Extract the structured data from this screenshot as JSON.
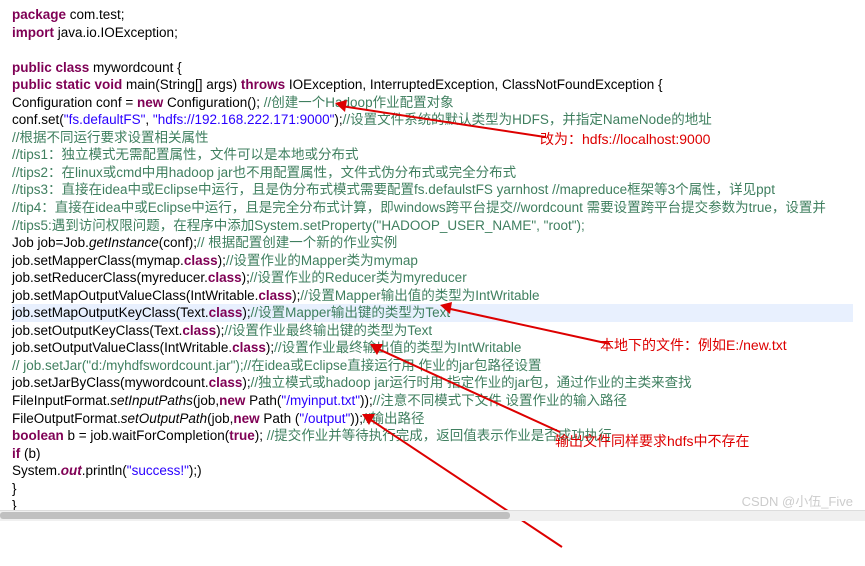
{
  "lines": {
    "l1_pkg": "package",
    "l1_pkgname": " com.test;",
    "l2_imp": "import",
    "l2_impname": " java.io.IOException;",
    "l4_pc": "public class",
    "l4_cls": " mywordcount {",
    "l5_psv": "   public static void",
    "l5_main": " main(String[] args) ",
    "l5_thr": "throws",
    "l5_exc": " IOException, InterruptedException, ClassNotFoundException {",
    "l6_a": "      Configuration conf = ",
    "l6_new": "new",
    "l6_b": " Configuration(); ",
    "l6_c": "//创建一个Hadoop作业配置对象",
    "l7_a": "      conf.set(",
    "l7_s1": "\"fs.defaultFS\"",
    "l7_comma": ", ",
    "l7_s2": "\"hdfs://192.168.222.171:9000\"",
    "l7_b": ");",
    "l7_c": "//设置文件系统的默认类型为HDFS，并指定NameNode的地址",
    "l8_c": "      //根据不同运行要求设置相关属性",
    "l9_c": "      //tips1：独立模式无需配置属性，文件可以是本地或分布式",
    "l10_c": "      //tips2：在linux或cmd中用hadoop jar也不用配置属性，文件式伪分布式或完全分布式",
    "l11_c": "      //tips3：直接在idea中或Eclipse中运行，且是伪分布式模式需要配置fs.defaulstFS yarnhost //mapreduce框架等3个属性，详见ppt",
    "l12_c": "      //tip4：直接在idea中或Eclipse中运行，且是完全分布式计算，即windows跨平台提交//wordcount 需要设置跨平台提交参数为true，设置并",
    "l13_c": "      //tips5:遇到访问权限问题，在程序中添加System.setProperty(\"HADOOP_USER_NAME\", \"root\");",
    "l14_a": "      Job job=Job.",
    "l14_gi": "getInstance",
    "l14_b": "(conf);",
    "l14_c": "// 根据配置创建一个新的作业实例",
    "l15_a": "      job.setMapperClass(mymap.",
    "l15_cls": "class",
    "l15_b": ");",
    "l15_c": "//设置作业的Mapper类为mymap",
    "l16_a": "      job.setReducerClass(myreducer.",
    "l16_cls": "class",
    "l16_b": ");",
    "l16_c": "//设置作业的Reducer类为myreducer",
    "l17_a": "      job.setMapOutputValueClass(IntWritable.",
    "l17_cls": "class",
    "l17_b": ");",
    "l17_c": "//设置Mapper输出值的类型为IntWritable",
    "l18_a": "      job.setMapOutputKeyClass(Text.",
    "l18_cls": "class",
    "l18_b": ");",
    "l18_c": "//设置Mapper输出键的类型为Text",
    "l19_a": "      job.setOutputKeyClass(Text.",
    "l19_cls": "class",
    "l19_b": ");",
    "l19_c": "//设置作业最终输出键的类型为Text",
    "l20_a": "      job.setOutputValueClass(IntWritable.",
    "l20_cls": "class",
    "l20_b": ");",
    "l20_c": "//设置作业最终输出值的类型为IntWritable",
    "l21_c": "      // job.setJar(\"d:/myhdfswordcount.jar\");//在idea或Eclipse直接运行用 作业的jar包路径设置",
    "l22_a": "      job.setJarByClass(mywordcount.",
    "l22_cls": "class",
    "l22_b": ");",
    "l22_c": "//独立模式或hadoop jar运行时用 指定作业的jar包，通过作业的主类来查找",
    "l23_a": "      FileInputFormat.",
    "l23_sip": "setInputPaths",
    "l23_b": "(job,",
    "l23_new": "new",
    "l23_c": " Path(",
    "l23_s": "\"/myinput.txt\"",
    "l23_d": "));",
    "l23_e": "//注意不同模式下文件 设置作业的输入路径",
    "l24_a": "      FileOutputFormat.",
    "l24_sop": "setOutputPath",
    "l24_b": "(job,",
    "l24_new": "new",
    "l24_c": " Path (",
    "l24_s": "\"/output\"",
    "l24_d": "));",
    "l24_e": "//输出路径",
    "l25_bool": "      boolean",
    "l25_a": " b = job.waitForCompletion(",
    "l25_true": "true",
    "l25_b": "); ",
    "l25_c": "//提交作业并等待执行完成，返回值表示作业是否成功执行",
    "l26_if": "      if",
    "l26_a": " (b)",
    "l27_a": "         System.",
    "l27_out": "out",
    "l27_b": ".println(",
    "l27_s": "\"success!\"",
    "l27_c": ");)",
    "l28": "   }",
    "l29": "}",
    "ann1": "改为：hdfs://localhost:9000",
    "ann2": "本地下的文件：例如E:/new.txt",
    "ann3": "输出文件同样要求hdfs中不存在",
    "watermark": "CSDN @小伍_Five"
  }
}
